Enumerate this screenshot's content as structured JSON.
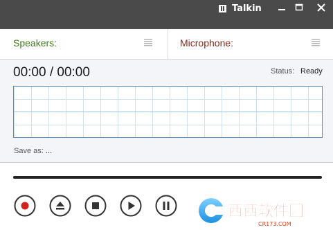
{
  "window": {
    "title": "Talkin"
  },
  "devices": {
    "speakers_label": "Speakers:",
    "microphone_label": "Microphone:"
  },
  "recorder": {
    "timer": "00:00 / 00:00",
    "status_label": "Status:",
    "status_value": "Ready",
    "save_as_label": "Save as:",
    "save_as_value": "..."
  },
  "watermark": {
    "text": "西西软件园",
    "site": "CR173.COM"
  },
  "colors": {
    "speakers": "#3f7a1d",
    "microphone": "#8b2a1c",
    "record": "#d0251f",
    "titlebar": "#4a4a4a"
  }
}
